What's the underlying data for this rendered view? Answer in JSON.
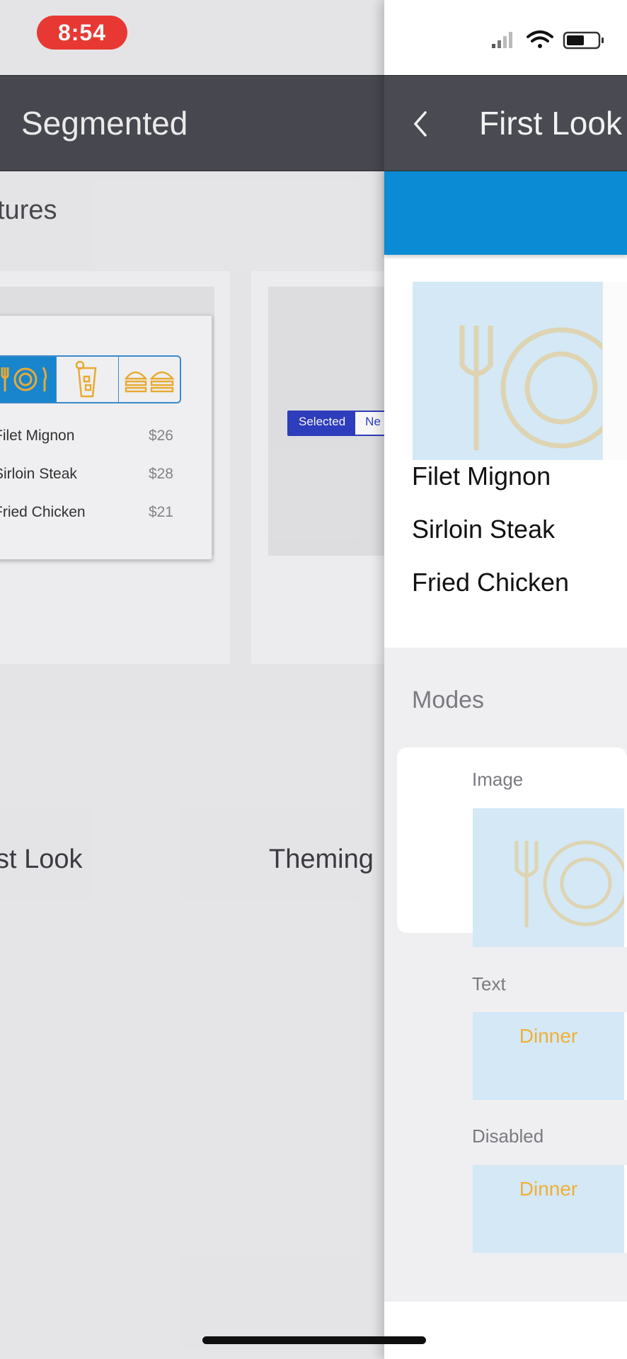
{
  "status_bar": {
    "time": "8:54",
    "icons": [
      "cellular-signal-icon",
      "wifi-icon",
      "battery-icon"
    ]
  },
  "back_page": {
    "nav_title": "Segmented",
    "section_title": "tures",
    "cards": [
      {
        "label": "st Look",
        "preview_menu": [
          {
            "name": "Filet Mignon",
            "price": "$26"
          },
          {
            "name": "Sirloin Steak",
            "price": "$28"
          },
          {
            "name": "Fried Chicken",
            "price": "$21"
          }
        ]
      },
      {
        "label": "Theming",
        "preview_segments": {
          "selected": "Selected",
          "unselected": "Ne"
        }
      }
    ]
  },
  "front_page": {
    "nav_title": "First Look",
    "menu_items": [
      "Filet Mignon",
      "Sirloin Steak",
      "Fried Chicken"
    ],
    "modes_title": "Modes",
    "modes": [
      {
        "label": "Image"
      },
      {
        "label": "Text",
        "value": "Dinner"
      },
      {
        "label": "Disabled",
        "value": "Dinner"
      }
    ]
  },
  "colors": {
    "nav": "#4a4a52",
    "accent_blue": "#0a8bd3",
    "orange": "#f0b035",
    "status_red": "#f03a35",
    "selection_tint": "#d4e8f6"
  }
}
